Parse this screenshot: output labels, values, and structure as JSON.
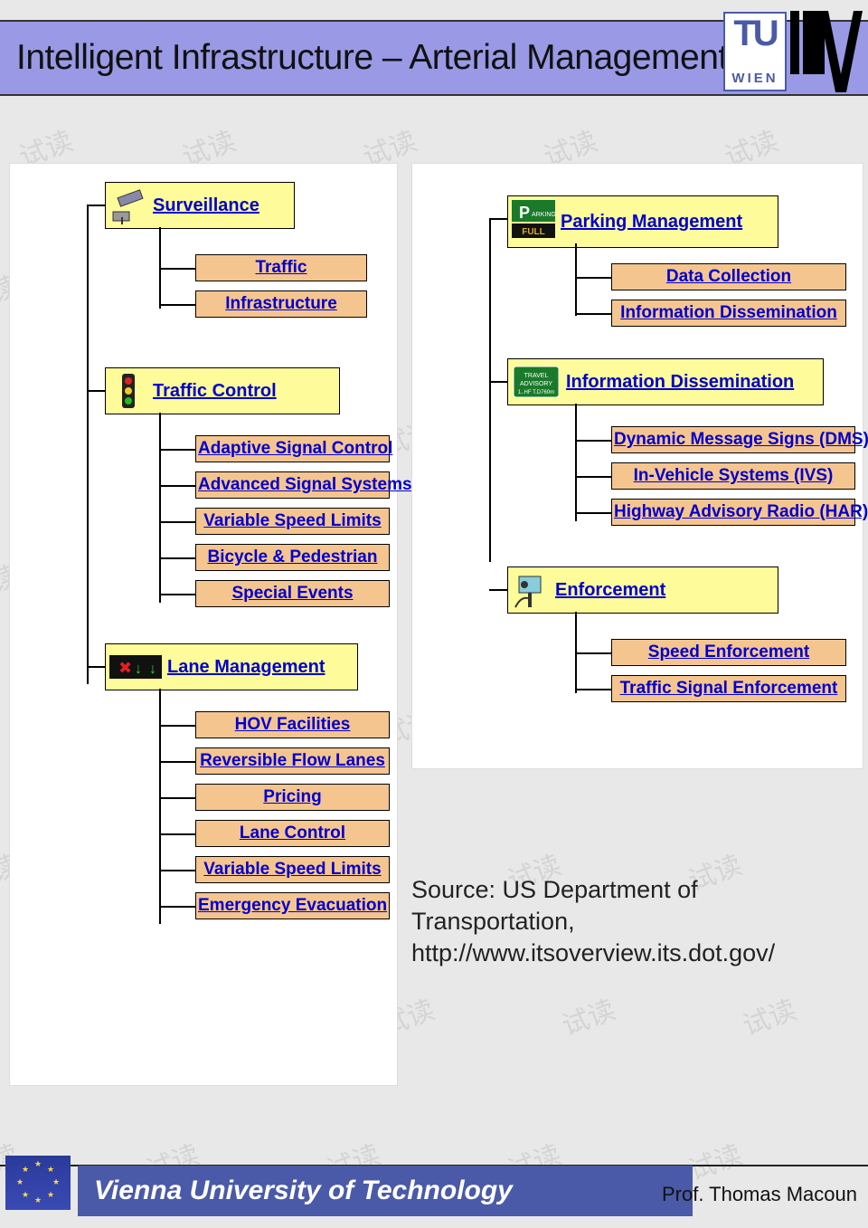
{
  "header": {
    "title": "Intelligent Infrastructure – Arterial Management"
  },
  "logo": {
    "tu_top": "TU",
    "tu_bottom": "WIEN"
  },
  "watermark": "试读",
  "left": {
    "surveillance": {
      "label": "Surveillance",
      "children": [
        "Traffic",
        "Infrastructure"
      ]
    },
    "traffic_control": {
      "label": "Traffic Control",
      "children": [
        "Adaptive Signal Control",
        "Advanced Signal Systems",
        "Variable Speed Limits",
        "Bicycle & Pedestrian",
        "Special Events"
      ]
    },
    "lane_mgmt": {
      "label": "Lane Management",
      "children": [
        "HOV Facilities",
        "Reversible Flow Lanes",
        "Pricing",
        "Lane Control",
        "Variable Speed Limits",
        "Emergency Evacuation"
      ]
    }
  },
  "right": {
    "parking": {
      "label": "Parking Management",
      "children": [
        "Data Collection",
        "Information Dissemination"
      ]
    },
    "info": {
      "label": "Information Dissemination",
      "children": [
        "Dynamic Message Signs (DMS)",
        "In-Vehicle Systems (IVS)",
        "Highway Advisory Radio (HAR)"
      ]
    },
    "enforcement": {
      "label": "Enforcement",
      "children": [
        "Speed Enforcement",
        "Traffic Signal Enforcement"
      ]
    }
  },
  "source": {
    "line1": "Source: US Department of Transportation,",
    "line2": "http://www.itsoverview.its.dot.gov/"
  },
  "footer": {
    "university": "Vienna University of Technology",
    "author": "Prof. Thomas Macoun"
  }
}
